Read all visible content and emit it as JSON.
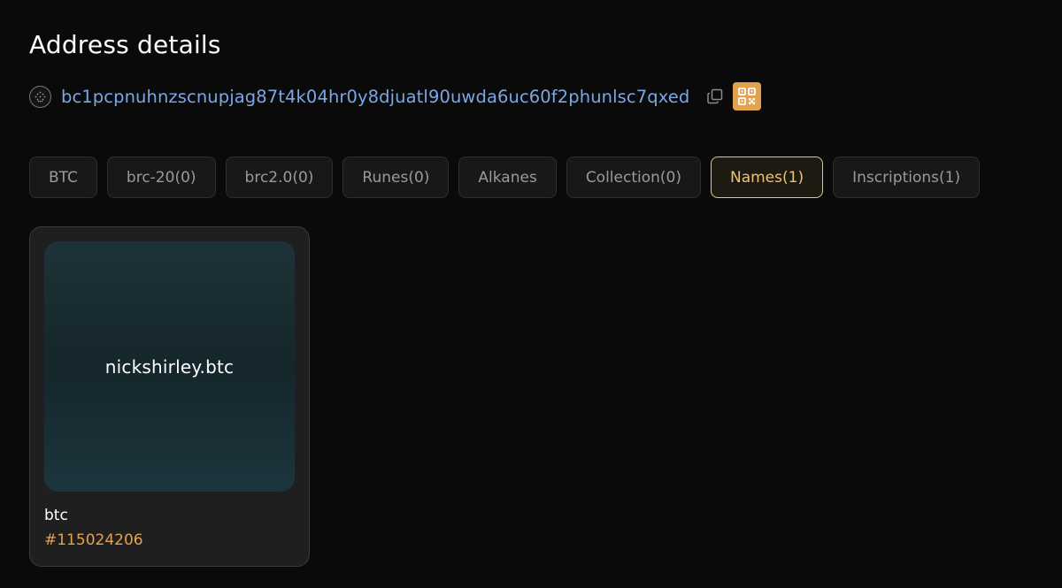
{
  "header": {
    "title": "Address details"
  },
  "address": {
    "avatar_icon": "dot-pattern-avatar-icon",
    "value": "bc1pcpnuhnzscnupjag87t4k04hr0y8djuatl90uwda6uc60f2phunlsc7qxed",
    "copy_icon": "copy-icon",
    "qr_icon": "qr-code-icon",
    "link_color": "#7aa7e6",
    "qr_color": "#e3a24e"
  },
  "tabs": [
    {
      "label": "BTC",
      "active": false
    },
    {
      "label": "brc-20(0)",
      "active": false
    },
    {
      "label": "brc2.0(0)",
      "active": false
    },
    {
      "label": "Runes(0)",
      "active": false
    },
    {
      "label": "Alkanes",
      "active": false
    },
    {
      "label": "Collection(0)",
      "active": false
    },
    {
      "label": "Names(1)",
      "active": true
    },
    {
      "label": "Inscriptions(1)",
      "active": false
    }
  ],
  "active_color": "#f2c26b",
  "names": [
    {
      "preview_text": "nickshirley.btc",
      "type": "btc",
      "inscription_number": "#115024206"
    }
  ]
}
